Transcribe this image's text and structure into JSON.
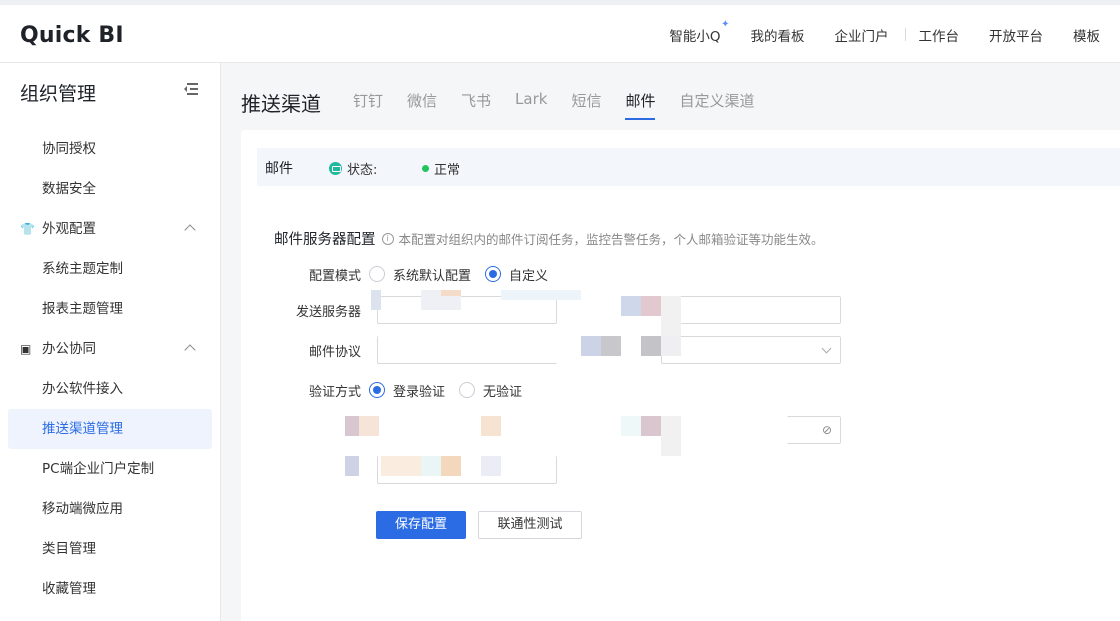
{
  "header": {
    "logo": "Quick BI",
    "nav": [
      "智能小Q",
      "我的看板",
      "企业门户",
      "工作台",
      "开放平台",
      "模板"
    ]
  },
  "sidebar": {
    "title": "组织管理",
    "items": [
      {
        "label": "协同授权"
      },
      {
        "label": "数据安全"
      }
    ],
    "group_appearance": "外观配置",
    "appearance_items": [
      "系统主题定制",
      "报表主题管理"
    ],
    "group_office": "办公协同",
    "office_items": [
      "办公软件接入",
      "推送渠道管理",
      "PC端企业门户定制",
      "移动端微应用",
      "类目管理",
      "收藏管理"
    ]
  },
  "main": {
    "title": "推送渠道",
    "tabs": [
      "钉钉",
      "微信",
      "飞书",
      "Lark",
      "短信",
      "邮件",
      "自定义渠道"
    ],
    "active_tab": "邮件",
    "status": {
      "channel": "邮件",
      "label": "状态:",
      "value": "正常"
    },
    "section": {
      "title": "邮件服务器配置",
      "hint": "本配置对组织内的邮件订阅任务，监控告警任务，个人邮箱验证等功能生效。"
    },
    "form": {
      "mode_label": "配置模式",
      "mode_options": [
        "系统默认配置",
        "自定义"
      ],
      "mode_selected": "自定义",
      "server_label": "发送服务器",
      "protocol_label": "邮件协议",
      "auth_label": "验证方式",
      "auth_options": [
        "登录验证",
        "无验证"
      ],
      "auth_selected": "登录验证"
    },
    "buttons": {
      "save": "保存配置",
      "test": "联通性测试"
    }
  },
  "colors": {
    "accent": "#2b6ce4",
    "status_ok": "#21c55d"
  }
}
